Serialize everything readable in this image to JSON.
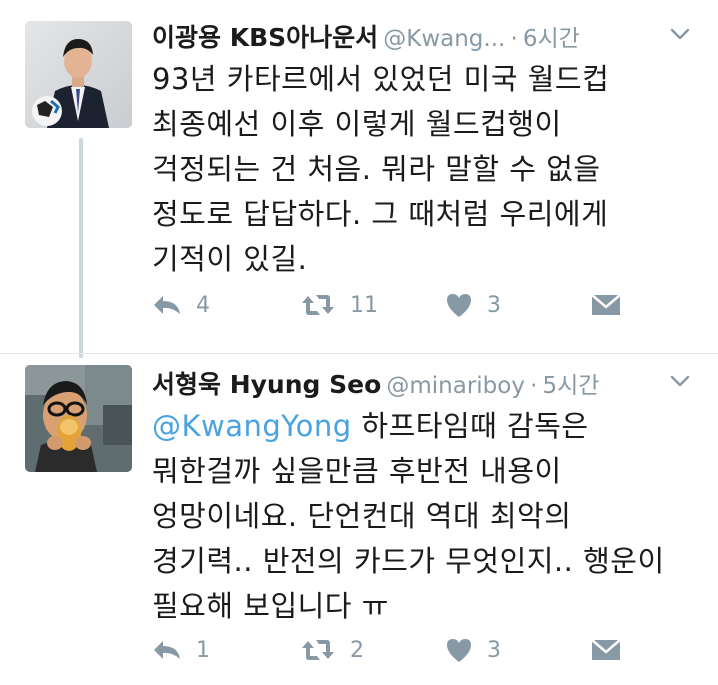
{
  "tweets": [
    {
      "display_name": "이광용 KBS아나운서",
      "handle": "@Kwang...",
      "separator": "·",
      "time": "6시간",
      "lines": [
        "93년 카타르에서 있었던 미국 월드컵",
        "최종예선 이후 이렇게 월드컵행이",
        "걱정되는 건 처음. 뭐라 말할 수 없을",
        "정도로 답답하다. 그 때처럼 우리에게",
        "기적이 있길."
      ],
      "replies": "4",
      "retweets": "11",
      "likes": "3"
    },
    {
      "display_name": "서형욱 Hyung Seo",
      "handle": "@minariboy",
      "separator": "·",
      "time": "5시간",
      "mention": "@KwangYong",
      "line1_rest": " 하프타임때 감독은",
      "lines": [
        "뭐한걸까 싶을만큼 후반전 내용이",
        "엉망이네요. 단언컨대 역대 최악의",
        "경기력.. 반전의 카드가 무엇인지.. 행운이",
        "필요해 보입니다 ㅠ"
      ],
      "replies": "1",
      "retweets": "2",
      "likes": "3"
    }
  ],
  "colors": {
    "icon": "#8899a6",
    "mention": "#4aa3e0",
    "thread_line": "#cdd7de"
  },
  "icons": [
    "reply-icon",
    "retweet-icon",
    "like-icon",
    "direct-message-icon",
    "chevron-down-icon"
  ]
}
